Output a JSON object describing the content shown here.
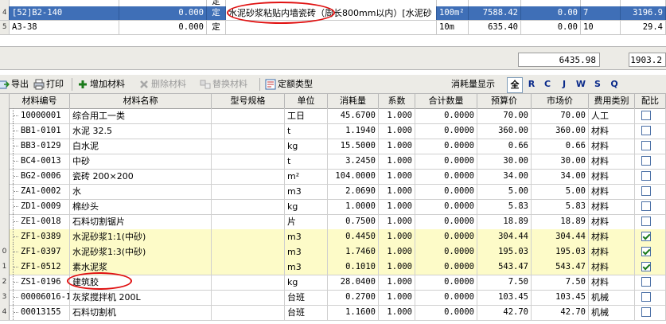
{
  "top_rows": [
    {
      "rowno": "",
      "code": "",
      "qty": "",
      "type": "定",
      "desc": "",
      "unit": "",
      "price": "",
      "amount": "",
      "n": "",
      "total": ""
    },
    {
      "rowno": "4",
      "code": "[52]B2-140",
      "qty": "0.000",
      "type": "定",
      "desc": "水泥砂浆粘贴内墙瓷砖（周长800mm以内）[水泥砂",
      "unit": "100m²",
      "price": "7588.42",
      "amount": "0.00",
      "n": "7",
      "total": "3196.9"
    },
    {
      "rowno": "5",
      "code": "A3-38",
      "qty": "0.000",
      "type": "定",
      "desc": "",
      "unit": "10m",
      "price": "635.40",
      "amount": "0.00",
      "n": "10",
      "total": "29.4"
    }
  ],
  "summary": {
    "left": "6435.98",
    "right": "1903.2"
  },
  "toolbar": {
    "export": "导出",
    "print": "打印",
    "add": "增加材料",
    "delete": "删除材料",
    "replace": "替换材料",
    "quota_type": "定额类型",
    "display_label": "消耗量显示",
    "filters": [
      "全",
      "R",
      "C",
      "J",
      "W",
      "S",
      "Q"
    ],
    "active_filter": "全"
  },
  "columns": [
    "材料编号",
    "材料名称",
    "型号规格",
    "单位",
    "消耗量",
    "系数",
    "合计数量",
    "预算价",
    "市场价",
    "费用类别",
    "配比"
  ],
  "rows": [
    {
      "rowno": "",
      "code": "10000001",
      "name": "综合用工一类",
      "spec": "",
      "unit": "工日",
      "consumption": "45.6700",
      "factor": "1.000",
      "total": "0.0000",
      "budget": "70.00",
      "market": "70.00",
      "category": "人工",
      "ratio": false,
      "yellow": false
    },
    {
      "rowno": "",
      "code": "BB1-0101",
      "name": "水泥 32.5",
      "spec": "",
      "unit": "t",
      "consumption": "1.1940",
      "factor": "1.000",
      "total": "0.0000",
      "budget": "360.00",
      "market": "360.00",
      "category": "材料",
      "ratio": false,
      "yellow": false
    },
    {
      "rowno": "",
      "code": "BB3-0129",
      "name": "白水泥",
      "spec": "",
      "unit": "kg",
      "consumption": "15.5000",
      "factor": "1.000",
      "total": "0.0000",
      "budget": "0.66",
      "market": "0.66",
      "category": "材料",
      "ratio": false,
      "yellow": false
    },
    {
      "rowno": "",
      "code": "BC4-0013",
      "name": "中砂",
      "spec": "",
      "unit": "t",
      "consumption": "3.2450",
      "factor": "1.000",
      "total": "0.0000",
      "budget": "30.00",
      "market": "30.00",
      "category": "材料",
      "ratio": false,
      "yellow": false
    },
    {
      "rowno": "",
      "code": "BG2-0006",
      "name": "瓷砖 200×200",
      "spec": "",
      "unit": "m²",
      "consumption": "104.0000",
      "factor": "1.000",
      "total": "0.0000",
      "budget": "34.00",
      "market": "34.00",
      "category": "材料",
      "ratio": false,
      "yellow": false
    },
    {
      "rowno": "",
      "code": "ZA1-0002",
      "name": "水",
      "spec": "",
      "unit": "m3",
      "consumption": "2.0690",
      "factor": "1.000",
      "total": "0.0000",
      "budget": "5.00",
      "market": "5.00",
      "category": "材料",
      "ratio": false,
      "yellow": false
    },
    {
      "rowno": "",
      "code": "ZD1-0009",
      "name": "棉纱头",
      "spec": "",
      "unit": "kg",
      "consumption": "1.0000",
      "factor": "1.000",
      "total": "0.0000",
      "budget": "5.83",
      "market": "5.83",
      "category": "材料",
      "ratio": false,
      "yellow": false
    },
    {
      "rowno": "",
      "code": "ZE1-0018",
      "name": "石料切割锯片",
      "spec": "",
      "unit": "片",
      "consumption": "0.7500",
      "factor": "1.000",
      "total": "0.0000",
      "budget": "18.89",
      "market": "18.89",
      "category": "材料",
      "ratio": false,
      "yellow": false
    },
    {
      "rowno": "",
      "code": "ZF1-0389",
      "name": "水泥砂浆1:1(中砂)",
      "spec": "",
      "unit": "m3",
      "consumption": "0.4450",
      "factor": "1.000",
      "total": "0.0000",
      "budget": "304.44",
      "market": "304.44",
      "category": "材料",
      "ratio": true,
      "yellow": true
    },
    {
      "rowno": "0",
      "code": "ZF1-0397",
      "name": "水泥砂浆1:3(中砂)",
      "spec": "",
      "unit": "m3",
      "consumption": "1.7460",
      "factor": "1.000",
      "total": "0.0000",
      "budget": "195.03",
      "market": "195.03",
      "category": "材料",
      "ratio": true,
      "yellow": true
    },
    {
      "rowno": "1",
      "code": "ZF1-0512",
      "name": "素水泥浆",
      "spec": "",
      "unit": "m3",
      "consumption": "0.1010",
      "factor": "1.000",
      "total": "0.0000",
      "budget": "543.47",
      "market": "543.47",
      "category": "材料",
      "ratio": true,
      "yellow": true
    },
    {
      "rowno": "2",
      "code": "ZS1-0196",
      "name": "建筑胶",
      "spec": "",
      "unit": "kg",
      "consumption": "28.0400",
      "factor": "1.000",
      "total": "0.0000",
      "budget": "7.50",
      "market": "7.50",
      "category": "材料",
      "ratio": false,
      "yellow": false
    },
    {
      "rowno": "3",
      "code": "00006016-1",
      "name": "灰浆搅拌机 200L",
      "spec": "",
      "unit": "台班",
      "consumption": "0.2700",
      "factor": "1.000",
      "total": "0.0000",
      "budget": "103.45",
      "market": "103.45",
      "category": "机械",
      "ratio": false,
      "yellow": false
    },
    {
      "rowno": "4",
      "code": "00013155",
      "name": "石料切割机",
      "spec": "",
      "unit": "台班",
      "consumption": "1.1600",
      "factor": "1.000",
      "total": "0.0000",
      "budget": "42.70",
      "market": "42.70",
      "category": "机械",
      "ratio": false,
      "yellow": false
    }
  ]
}
